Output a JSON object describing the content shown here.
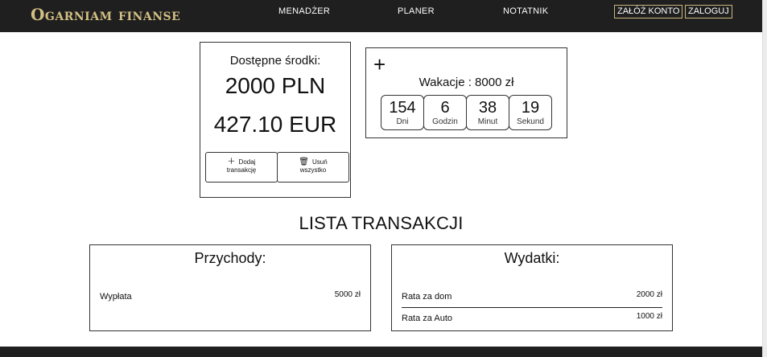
{
  "header": {
    "brand": "Ogarniam finanse",
    "nav": [
      "MENADŻER",
      "PLANER",
      "NOTATNIK"
    ],
    "register_label": "ZAŁÓŻ KONTO",
    "login_label": "ZALOGUJ"
  },
  "funds": {
    "title": "Dostępne środki:",
    "pln": "2000 PLN",
    "eur": "427.10 EUR",
    "add_line1": "Dodaj",
    "add_line2": "transakcję",
    "delete_line1": "Usuń",
    "delete_line2": "wszystko",
    "add_icon": "plus-icon",
    "delete_icon": "trash-icon"
  },
  "vacation": {
    "plus": "+",
    "title": "Wakacje : 8000 zł",
    "countdown": [
      {
        "value": "154",
        "label": "Dni"
      },
      {
        "value": "6",
        "label": "Godzin"
      },
      {
        "value": "38",
        "label": "Minut"
      },
      {
        "value": "19",
        "label": "Sekund"
      }
    ]
  },
  "transactions": {
    "title": "LISTA TRANSAKCJI",
    "income": {
      "title": "Przychody:",
      "items": [
        {
          "name": "Wypłata",
          "amount": "5000 zł"
        }
      ]
    },
    "expenses": {
      "title": "Wydatki:",
      "items": [
        {
          "name": "Rata za dom",
          "amount": "2000 zł"
        },
        {
          "name": "Rata za Auto",
          "amount": "1000 zł"
        }
      ]
    }
  },
  "colors": {
    "header_bg": "#1f1f1f",
    "brand_gold": "#d3bf84"
  }
}
